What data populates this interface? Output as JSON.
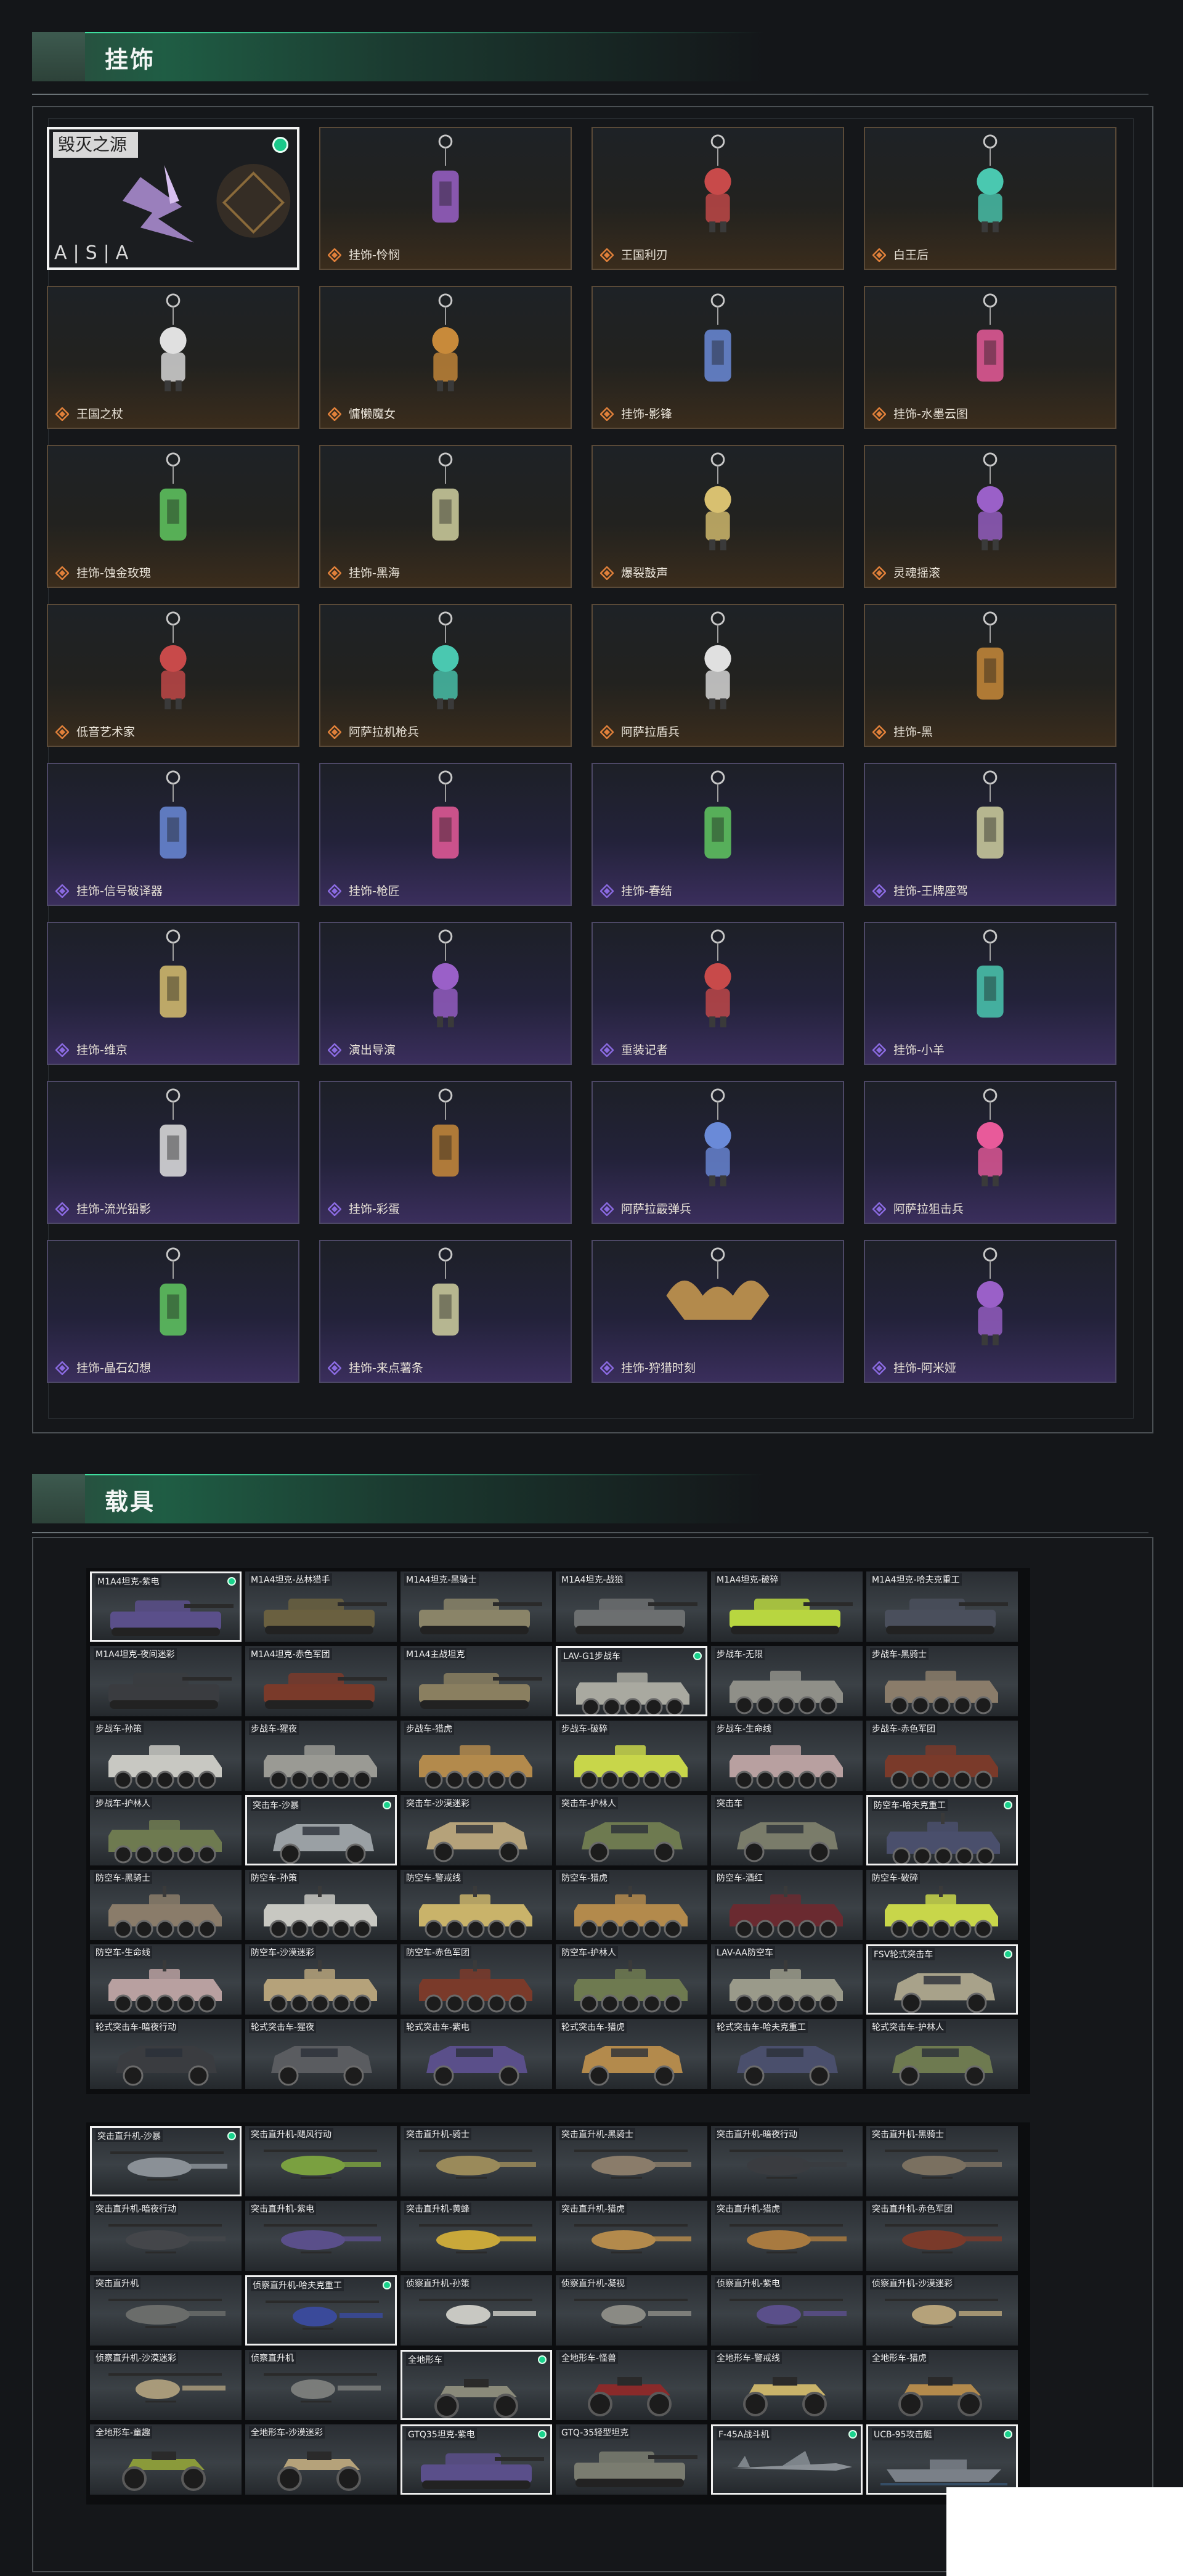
{
  "sections": {
    "ornaments": {
      "title": "挂饰"
    },
    "vehicles": {
      "title": "载具"
    }
  },
  "ornaments": {
    "selected": {
      "title": "毁灭之源",
      "footer": "A|S|A",
      "equipped": true
    },
    "items": [
      {
        "label": "毁灭之源",
        "rarity": "selected",
        "icon": "mech-dragon-icon"
      },
      {
        "label": "挂饰-怜悯",
        "rarity": "orange",
        "icon": "dagger-icon"
      },
      {
        "label": "王国利刃",
        "rarity": "orange",
        "icon": "knight-figure-icon"
      },
      {
        "label": "白王后",
        "rarity": "orange",
        "icon": "queen-figure-icon"
      },
      {
        "label": "王国之杖",
        "rarity": "orange",
        "icon": "king-figure-icon"
      },
      {
        "label": "慵懒魔女",
        "rarity": "orange",
        "icon": "witch-figure-icon"
      },
      {
        "label": "挂饰-影锋",
        "rarity": "orange",
        "icon": "shadow-blade-icon"
      },
      {
        "label": "挂饰-水墨云图",
        "rarity": "orange",
        "icon": "ink-sphere-icon"
      },
      {
        "label": "挂饰-蚀金玫瑰",
        "rarity": "orange",
        "icon": "golden-rose-icon"
      },
      {
        "label": "挂饰-黑海",
        "rarity": "orange",
        "icon": "anchor-icon"
      },
      {
        "label": "爆裂鼓声",
        "rarity": "orange",
        "icon": "drummer-figure-icon"
      },
      {
        "label": "灵魂摇滚",
        "rarity": "orange",
        "icon": "guitarist-figure-icon"
      },
      {
        "label": "低音艺术家",
        "rarity": "orange",
        "icon": "bassist-figure-icon"
      },
      {
        "label": "阿萨拉机枪兵",
        "rarity": "orange",
        "icon": "gunner-figure-icon"
      },
      {
        "label": "阿萨拉盾兵",
        "rarity": "orange",
        "icon": "shield-soldier-icon"
      },
      {
        "label": "挂饰-黑",
        "rarity": "orange",
        "icon": "black-tag-icon"
      },
      {
        "label": "挂饰-信号破译器",
        "rarity": "purple",
        "icon": "signal-decoder-icon"
      },
      {
        "label": "挂饰-枪匠",
        "rarity": "purple",
        "icon": "gunsmith-bag-icon"
      },
      {
        "label": "挂饰-春结",
        "rarity": "purple",
        "icon": "chinese-knot-icon"
      },
      {
        "label": "挂饰-王牌座驾",
        "rarity": "purple",
        "icon": "jet-plane-icon"
      },
      {
        "label": "挂饰-维京",
        "rarity": "purple",
        "icon": "viking-hammer-icon"
      },
      {
        "label": "演出导演",
        "rarity": "purple",
        "icon": "director-figure-icon"
      },
      {
        "label": "重装记者",
        "rarity": "purple",
        "icon": "reporter-figure-icon"
      },
      {
        "label": "挂饰-小羊",
        "rarity": "purple",
        "icon": "lamb-icon"
      },
      {
        "label": "挂饰-流光铅影",
        "rarity": "purple",
        "icon": "pencil-charm-icon"
      },
      {
        "label": "挂饰-彩蛋",
        "rarity": "purple",
        "icon": "green-egg-icon"
      },
      {
        "label": "阿萨拉霰弹兵",
        "rarity": "purple",
        "icon": "shotgunner-figure-icon"
      },
      {
        "label": "阿萨拉狙击兵",
        "rarity": "purple",
        "icon": "sniper-figure-icon"
      },
      {
        "label": "挂饰-晶石幻想",
        "rarity": "purple",
        "icon": "crystal-cube-icon"
      },
      {
        "label": "挂饰-来点薯条",
        "rarity": "purple",
        "icon": "fries-icon"
      },
      {
        "label": "挂饰-狩猎时刻",
        "rarity": "purple",
        "icon": "antlers-icon"
      },
      {
        "label": "挂饰-阿米娅",
        "rarity": "purple",
        "icon": "bunny-figure-icon"
      }
    ]
  },
  "vehicles": {
    "ground": [
      {
        "label": "M1A4坦克-紫电",
        "type": "tank",
        "color": "#5a4f8a",
        "selected": true
      },
      {
        "label": "M1A4坦克-丛林猎手",
        "type": "tank",
        "color": "#6a6040"
      },
      {
        "label": "M1A4坦克-黑骑士",
        "type": "tank",
        "color": "#8a8468"
      },
      {
        "label": "M1A4坦克-战狼",
        "type": "tank",
        "color": "#6c6f70"
      },
      {
        "label": "M1A4坦克-破碎",
        "type": "tank",
        "color": "#b8d640"
      },
      {
        "label": "M1A4坦克-哈夫克重工",
        "type": "tank",
        "color": "#4a4f5c"
      },
      {
        "label": "M1A4坦克-夜间迷彩",
        "type": "tank",
        "color": "#3a3c40"
      },
      {
        "label": "M1A4坦克-赤色军团",
        "type": "tank",
        "color": "#7a3a2a"
      },
      {
        "label": "M1A4主战坦克",
        "type": "tank",
        "color": "#8a7f60"
      },
      {
        "label": "LAV-G1步战车",
        "type": "apc",
        "color": "#a9a9a0",
        "selected": true
      },
      {
        "label": "步战车-无限",
        "type": "apc",
        "color": "#8f8f88"
      },
      {
        "label": "步战车-黑骑士",
        "type": "apc",
        "color": "#8a7c6a"
      },
      {
        "label": "步战车-孙策",
        "type": "apc",
        "color": "#c8c8c2"
      },
      {
        "label": "步战车-猩夜",
        "type": "apc",
        "color": "#9a9a94"
      },
      {
        "label": "步战车-猎虎",
        "type": "apc",
        "color": "#b38a4c"
      },
      {
        "label": "步战车-破碎",
        "type": "apc",
        "color": "#c8d64a"
      },
      {
        "label": "步战车-生命线",
        "type": "apc",
        "color": "#b8a0a0"
      },
      {
        "label": "步战车-赤色军团",
        "type": "apc",
        "color": "#7a3a2a"
      },
      {
        "label": "步战车-护林人",
        "type": "apc",
        "color": "#6e7a50"
      },
      {
        "label": "突击车-沙暴",
        "type": "suv",
        "color": "#9aa0a4",
        "selected": true
      },
      {
        "label": "突击车-沙漠迷彩",
        "type": "suv",
        "color": "#b5a27a"
      },
      {
        "label": "突击车-护林人",
        "type": "suv",
        "color": "#6e7a50"
      },
      {
        "label": "突击车",
        "type": "suv",
        "color": "#7a7c6a"
      },
      {
        "label": "防空车-哈夫克重工",
        "type": "aa",
        "color": "#4a4f6c",
        "selected": true
      },
      {
        "label": "防空车-黑骑士",
        "type": "aa",
        "color": "#8a7c6a"
      },
      {
        "label": "防空车-孙策",
        "type": "aa",
        "color": "#c8c8c2"
      },
      {
        "label": "防空车-警戒线",
        "type": "aa",
        "color": "#c9b36a"
      },
      {
        "label": "防空车-猎虎",
        "type": "aa",
        "color": "#b38a4c"
      },
      {
        "label": "防空车-酒红",
        "type": "aa",
        "color": "#6a2a30"
      },
      {
        "label": "防空车-破碎",
        "type": "aa",
        "color": "#c8d64a"
      },
      {
        "label": "防空车-生命线",
        "type": "aa",
        "color": "#b8a0a0"
      },
      {
        "label": "防空车-沙漠迷彩",
        "type": "aa",
        "color": "#b5a27a"
      },
      {
        "label": "防空车-赤色军团",
        "type": "aa",
        "color": "#7a3a2a"
      },
      {
        "label": "防空车-护林人",
        "type": "aa",
        "color": "#6e7a50"
      },
      {
        "label": "LAV-AA防空车",
        "type": "aa",
        "color": "#9a9a8a"
      },
      {
        "label": "FSV轮式突击车",
        "type": "suv",
        "color": "#a8a28a",
        "selected": true
      },
      {
        "label": "轮式突击车-暗夜行动",
        "type": "suv",
        "color": "#3a3c40"
      },
      {
        "label": "轮式突击车-猩夜",
        "type": "suv",
        "color": "#5a5c60"
      },
      {
        "label": "轮式突击车-紫电",
        "type": "suv",
        "color": "#5a4f8a"
      },
      {
        "label": "轮式突击车-猎虎",
        "type": "suv",
        "color": "#b38a4c"
      },
      {
        "label": "轮式突击车-哈夫克重工",
        "type": "suv",
        "color": "#4a4f6c"
      },
      {
        "label": "轮式突击车-护林人",
        "type": "suv",
        "color": "#6e7a50"
      }
    ],
    "air": [
      {
        "label": "突击直升机-沙暴",
        "type": "heli",
        "color": "#8a9096",
        "selected": true
      },
      {
        "label": "突击直升机-飓风行动",
        "type": "heli",
        "color": "#7aa040"
      },
      {
        "label": "突击直升机-骑士",
        "type": "heli",
        "color": "#9a8a5a"
      },
      {
        "label": "突击直升机-黑骑士",
        "type": "heli",
        "color": "#8a7c6a"
      },
      {
        "label": "突击直升机-暗夜行动",
        "type": "heli",
        "color": "#3a3c40"
      },
      {
        "label": "突击直升机-黑骑士",
        "type": "heli",
        "color": "#7a7060"
      },
      {
        "label": "突击直升机-暗夜行动",
        "type": "heli",
        "color": "#44464a"
      },
      {
        "label": "突击直升机-紫电",
        "type": "heli",
        "color": "#5a4f8a"
      },
      {
        "label": "突击直升机-黄蜂",
        "type": "heli",
        "color": "#c9a83a"
      },
      {
        "label": "突击直升机-猎虎",
        "type": "heli",
        "color": "#b38a4c"
      },
      {
        "label": "突击直升机-猎虎",
        "type": "heli",
        "color": "#a87a40"
      },
      {
        "label": "突击直升机-赤色军团",
        "type": "heli",
        "color": "#7a3a2a"
      },
      {
        "label": "突击直升机",
        "type": "heli",
        "color": "#6a6c6a"
      },
      {
        "label": "侦察直升机-哈夫克重工",
        "type": "heli-light",
        "color": "#3a4a9a",
        "selected": true
      },
      {
        "label": "侦察直升机-孙策",
        "type": "heli-light",
        "color": "#c8c8c2"
      },
      {
        "label": "侦察直升机-凝视",
        "type": "heli-light",
        "color": "#8a8a84"
      },
      {
        "label": "侦察直升机-紫电",
        "type": "heli-light",
        "color": "#5a4f8a"
      },
      {
        "label": "侦察直升机-沙漠迷彩",
        "type": "heli-light",
        "color": "#b5a27a"
      },
      {
        "label": "侦察直升机-沙漠迷彩",
        "type": "heli-light",
        "color": "#a89a7a"
      },
      {
        "label": "侦察直升机",
        "type": "heli-light",
        "color": "#7a7c7a"
      },
      {
        "label": "全地形车",
        "type": "atv",
        "color": "#8a8a7a",
        "selected": true
      },
      {
        "label": "全地形车-怪兽",
        "type": "atv",
        "color": "#8a2a2a"
      },
      {
        "label": "全地形车-警戒线",
        "type": "atv",
        "color": "#c9b36a"
      },
      {
        "label": "全地形车-猎虎",
        "type": "atv",
        "color": "#b38a4c"
      },
      {
        "label": "全地形车-童趣",
        "type": "atv",
        "color": "#8a9a3a"
      },
      {
        "label": "全地形车-沙漠迷彩",
        "type": "atv",
        "color": "#b5a27a"
      },
      {
        "label": "GTQ35坦克-紫电",
        "type": "tank",
        "color": "#5a4f8a",
        "selected": true
      },
      {
        "label": "GTQ-35轻型坦克",
        "type": "tank",
        "color": "#7a7c70"
      },
      {
        "label": "F-45A战斗机",
        "type": "jet",
        "color": "#8a9096",
        "selected": true
      },
      {
        "label": "UCB-95攻击艇",
        "type": "boat",
        "color": "#7a8088",
        "selected": true
      }
    ]
  }
}
